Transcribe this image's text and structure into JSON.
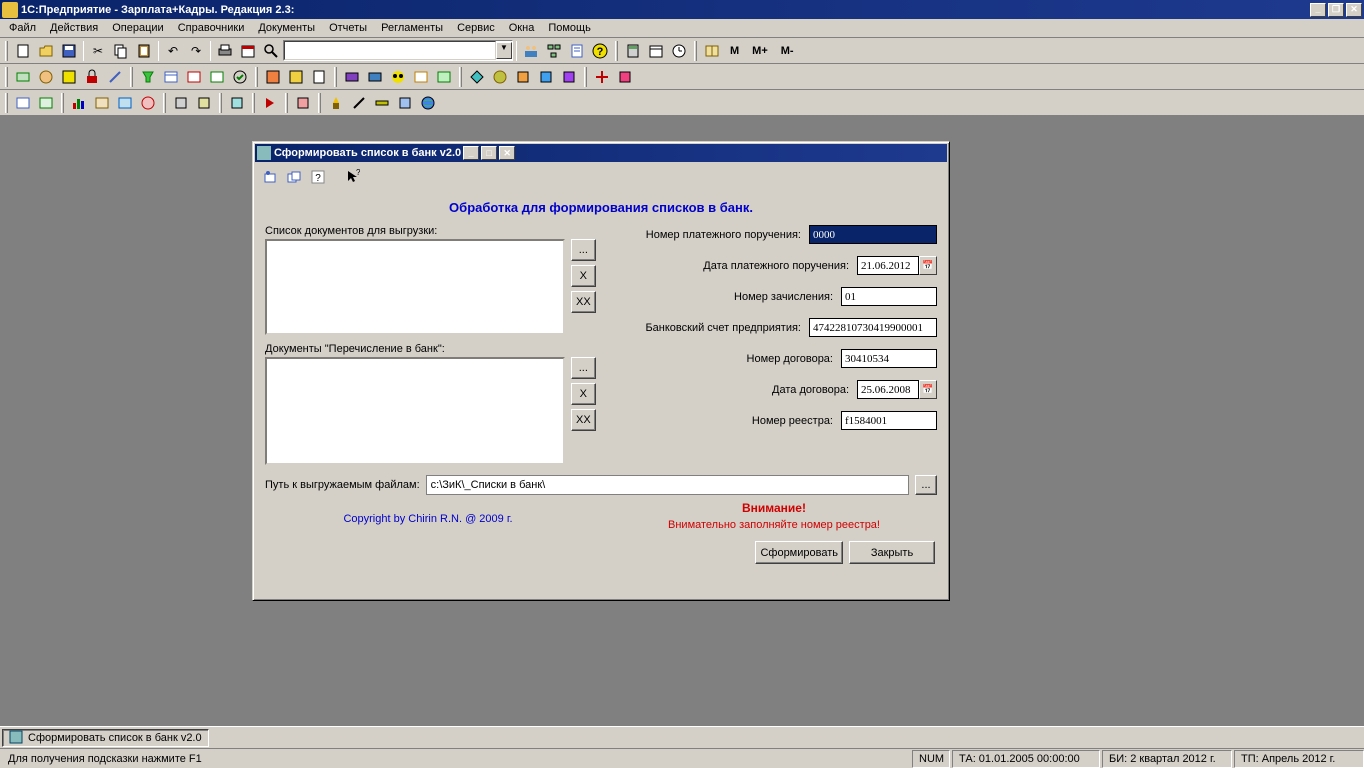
{
  "app": {
    "title": "1С:Предприятие - Зарплата+Кадры. Редакция 2.3:"
  },
  "menu": [
    "Файл",
    "Действия",
    "Операции",
    "Справочники",
    "Документы",
    "Отчеты",
    "Регламенты",
    "Сервис",
    "Окна",
    "Помощь"
  ],
  "m_buttons": [
    "M",
    "M+",
    "M-"
  ],
  "dialog": {
    "title": "Сформировать список в банк v2.0",
    "heading": "Обработка для формирования списков в банк.",
    "doclist_label": "Список документов для выгрузки:",
    "transfer_label": "Документы \"Перечисление в банк\":",
    "btn_browse": "...",
    "btn_remove": "X",
    "btn_remove_all": "XX",
    "fields": {
      "payment_number": {
        "label": "Номер платежного поручения:",
        "value": "0000"
      },
      "payment_date": {
        "label": "Дата платежного поручения:",
        "value": "21.06.2012"
      },
      "credit_number": {
        "label": "Номер зачисления:",
        "value": "01"
      },
      "bank_account": {
        "label": "Банковский счет предприятия:",
        "value": "47422810730419900001"
      },
      "contract_number": {
        "label": "Номер договора:",
        "value": "30410534"
      },
      "contract_date": {
        "label": "Дата договора:",
        "value": "25.06.2008"
      },
      "registry_number": {
        "label": "Номер реестра:",
        "value": "f1584001"
      }
    },
    "path": {
      "label": "Путь к выгружаемым файлам:",
      "value": "c:\\ЗиК\\_Списки в банк\\"
    },
    "copyright": "Copyright by Chirin R.N. @ 2009 г.",
    "warning_title": "Внимание!",
    "warning_text": "Внимательно заполняйте номер реестра!",
    "form_button": "Сформировать",
    "close_button": "Закрыть"
  },
  "taskbar": {
    "item": "Сформировать список в банк v2.0"
  },
  "status": {
    "hint": "Для получения подсказки нажмите F1",
    "num": "NUM",
    "ta": "ТА: 01.01.2005  00:00:00",
    "bi": "БИ: 2 квартал 2012 г.",
    "tp": "ТП: Апрель 2012 г."
  }
}
